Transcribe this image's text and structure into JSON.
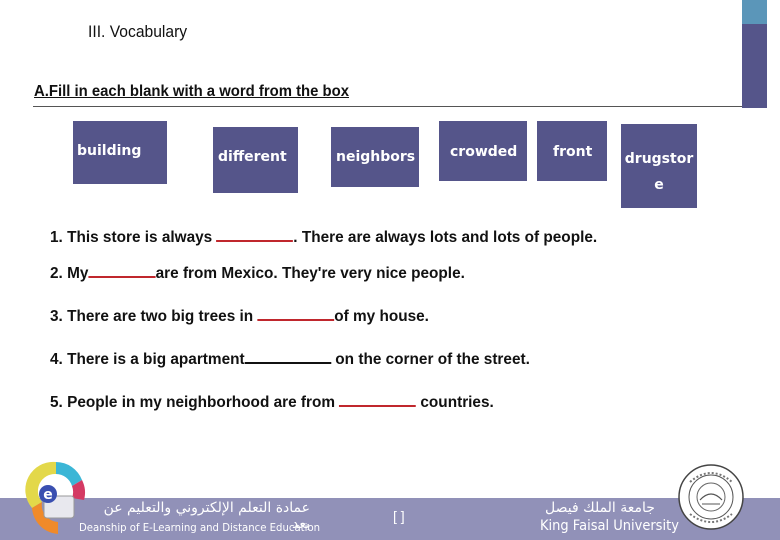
{
  "slide": {
    "section_title": "III. Vocabulary",
    "instruction": "A.Fill in each blank with a word from the box"
  },
  "word_box": {
    "words": [
      "building",
      "different",
      "neighbors",
      "crowded",
      "front",
      "drugstor\ne"
    ],
    "drugstore_line1": "drugstor",
    "drugstore_line2": "e"
  },
  "sentences": [
    {
      "before": "1.  This store is always ",
      "after": ". There are always lots and lots of people."
    },
    {
      "before": "2. My",
      "after": "are from Mexico. They're very nice people."
    },
    {
      "before": "3. There are two big trees in ",
      "after": "of my house."
    },
    {
      "before": "4. There is a big apartment",
      "after": " on the corner of the street."
    },
    {
      "before": "5. People in my neighborhood are from ",
      "after": " countries."
    }
  ],
  "footer": {
    "deanship_arabic": "عمادة التعلم الإلكتروني والتعليم عن بعد",
    "deanship_english": "Deanship of E-Learning and Distance Education",
    "page_number": "[      ]",
    "university_arabic": "جامعة الملك فيصل",
    "university_english": "King Faisal University"
  },
  "colors": {
    "accent_dark": "#55558a",
    "accent_light": "#5b96b9",
    "footer_band": "#9191b8",
    "blank_red": "#c0272d"
  }
}
